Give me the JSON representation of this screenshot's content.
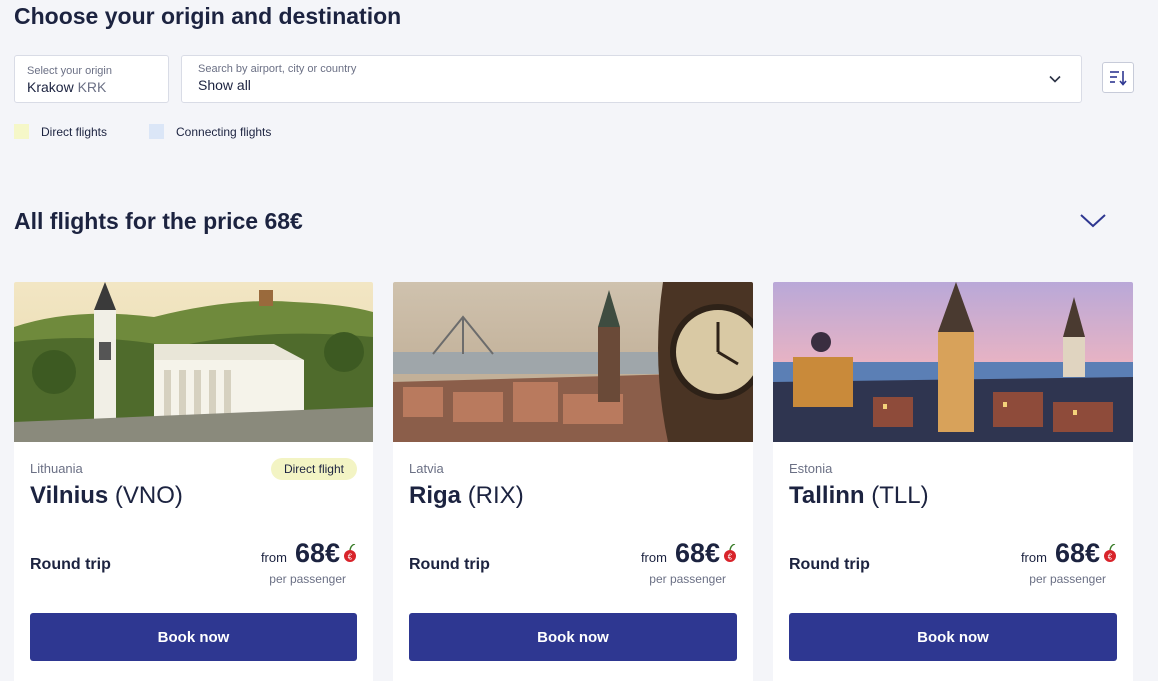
{
  "header": {
    "title": "Choose your origin and destination"
  },
  "origin": {
    "label": "Select your origin",
    "city": "Krakow",
    "code": "KRK"
  },
  "destination": {
    "placeholder": "Search by airport, city or country",
    "value": "Show all",
    "icon": "chevron-down-icon"
  },
  "sort": {
    "icon": "sort-descending-icon"
  },
  "legend": {
    "direct": {
      "label": "Direct flights",
      "color": "#f5f7c8"
    },
    "connecting": {
      "label": "Connecting flights",
      "color": "#dbe6f7"
    }
  },
  "section": {
    "title": "All flights for the price 68€",
    "toggle_icon": "chevron-down-icon"
  },
  "colors": {
    "primary": "#2e3791",
    "text": "#1c2340",
    "muted": "#6b7085",
    "background": "#f4f5f9",
    "badge": "#f3f4c4"
  },
  "cards": [
    {
      "country": "Lithuania",
      "badge": "Direct flight",
      "city": "Vilnius",
      "code": "(VNO)",
      "trip": "Round trip",
      "from": "from",
      "price": "68€",
      "per": "per passenger",
      "button": "Book now",
      "image": "vilnius-cathedral-photo"
    },
    {
      "country": "Latvia",
      "badge": "",
      "city": "Riga",
      "code": "(RIX)",
      "trip": "Round trip",
      "from": "from",
      "price": "68€",
      "per": "per passenger",
      "button": "Book now",
      "image": "riga-cityscape-photo"
    },
    {
      "country": "Estonia",
      "badge": "",
      "city": "Tallinn",
      "code": "(TLL)",
      "trip": "Round trip",
      "from": "from",
      "price": "68€",
      "per": "per passenger",
      "button": "Book now",
      "image": "tallinn-old-town-photo"
    }
  ]
}
